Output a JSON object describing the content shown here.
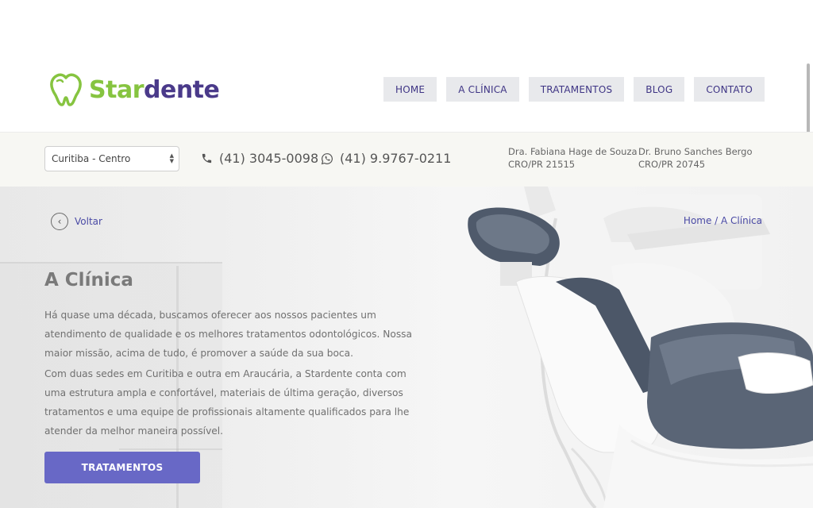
{
  "brand": {
    "name_part1": "Star",
    "name_part2": "dente",
    "green": "#86c440",
    "purple": "#4a3a8a"
  },
  "nav": {
    "items": [
      {
        "label": "HOME"
      },
      {
        "label": "A CLÍNICA"
      },
      {
        "label": "TRATAMENTOS"
      },
      {
        "label": "BLOG"
      },
      {
        "label": "CONTATO"
      }
    ]
  },
  "infobar": {
    "location_selected": "Curitiba - Centro",
    "phone": "(41) 3045-0098",
    "whatsapp": "(41) 9.9767-0211",
    "doctors": [
      {
        "name": "Dra. Fabiana Hage de Souza",
        "cro": "CRO/PR 21515"
      },
      {
        "name": "Dr. Bruno Sanches Bergo",
        "cro": "CRO/PR 20745"
      }
    ]
  },
  "hero": {
    "back_label": "Voltar",
    "breadcrumb": "Home / A Clínica",
    "title": "A Clínica",
    "paragraphs": [
      "Há quase uma década, buscamos oferecer aos nossos pacientes um atendimento de qualidade e os melhores tratamentos odontológicos. Nossa maior missão, acima de tudo, é promover a saúde da sua boca.",
      "Com duas sedes em Curitiba e outra em Araucária, a Stardente conta com uma estrutura ampla e confortável, materiais de última geração, diversos tratamentos e uma equipe de profissionais altamente qualificados para lhe atender da melhor maneira possível."
    ],
    "cta_label": "TRATAMENTOS"
  },
  "icons": {
    "logo": "tooth-outline-icon",
    "phone": "phone-icon",
    "whatsapp": "whatsapp-icon",
    "back": "chevron-left-icon",
    "select": "select-arrows-icon"
  }
}
